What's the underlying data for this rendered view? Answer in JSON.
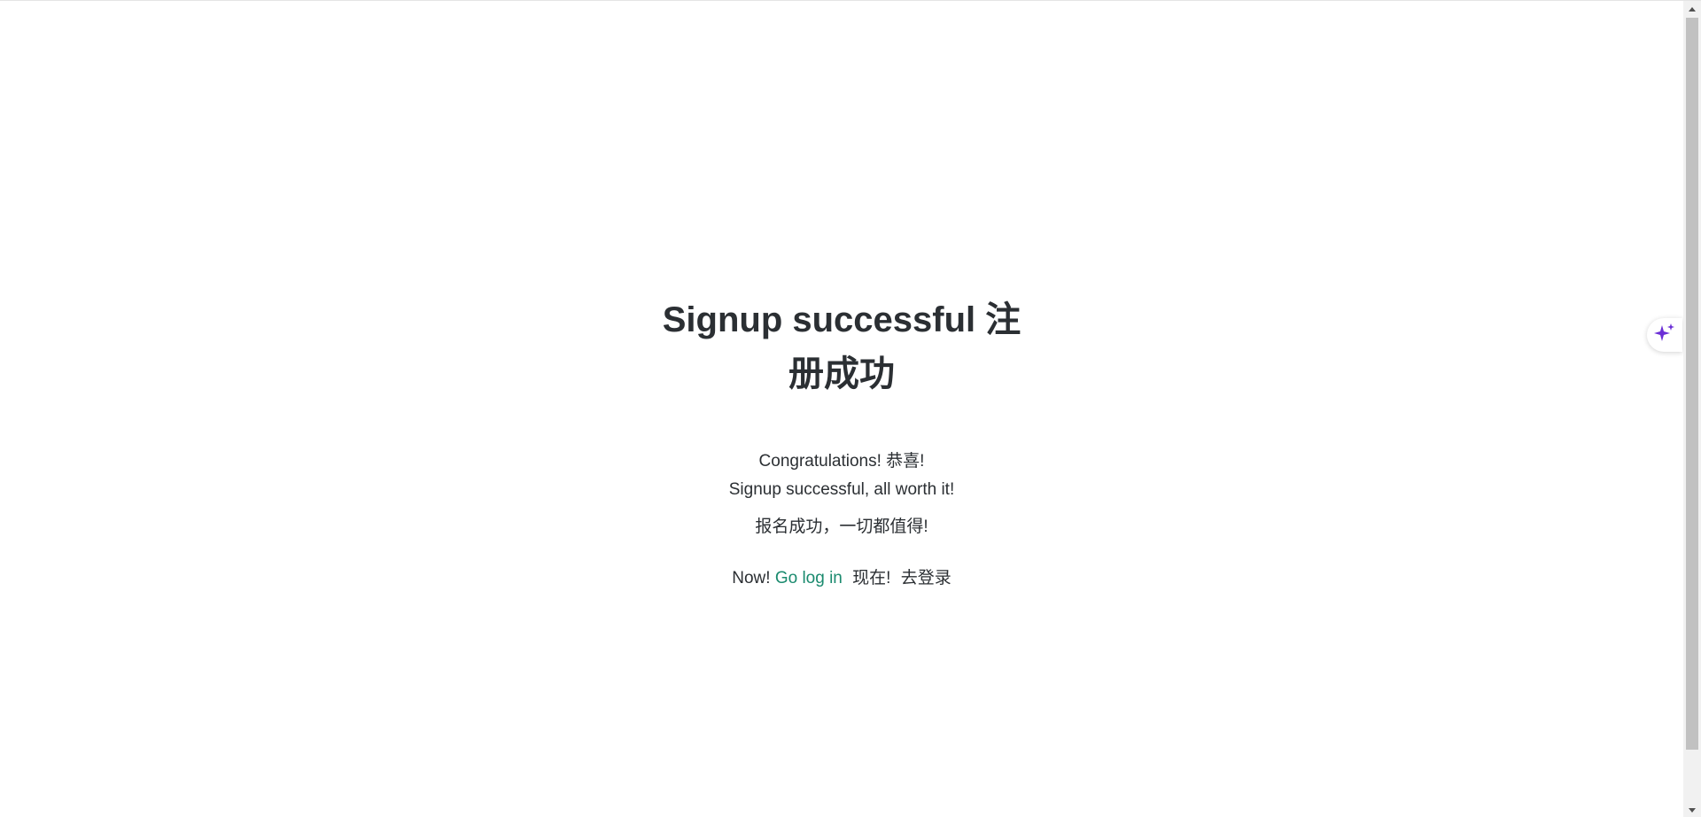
{
  "main": {
    "title": "Signup successful 注册成功",
    "line1": "Congratulations! 恭喜!",
    "line2": "Signup successful, all worth it!",
    "line3": "报名成功，一切都值得!",
    "now_label": "Now!",
    "login_link": "Go log in",
    "now_cn": "现在!",
    "login_cn": "去登录"
  },
  "floating": {
    "ai_icon": "sparkle-icon",
    "accent": "#6b2fd6"
  },
  "colors": {
    "text": "#2b2f33",
    "link": "#1a8a6e"
  }
}
